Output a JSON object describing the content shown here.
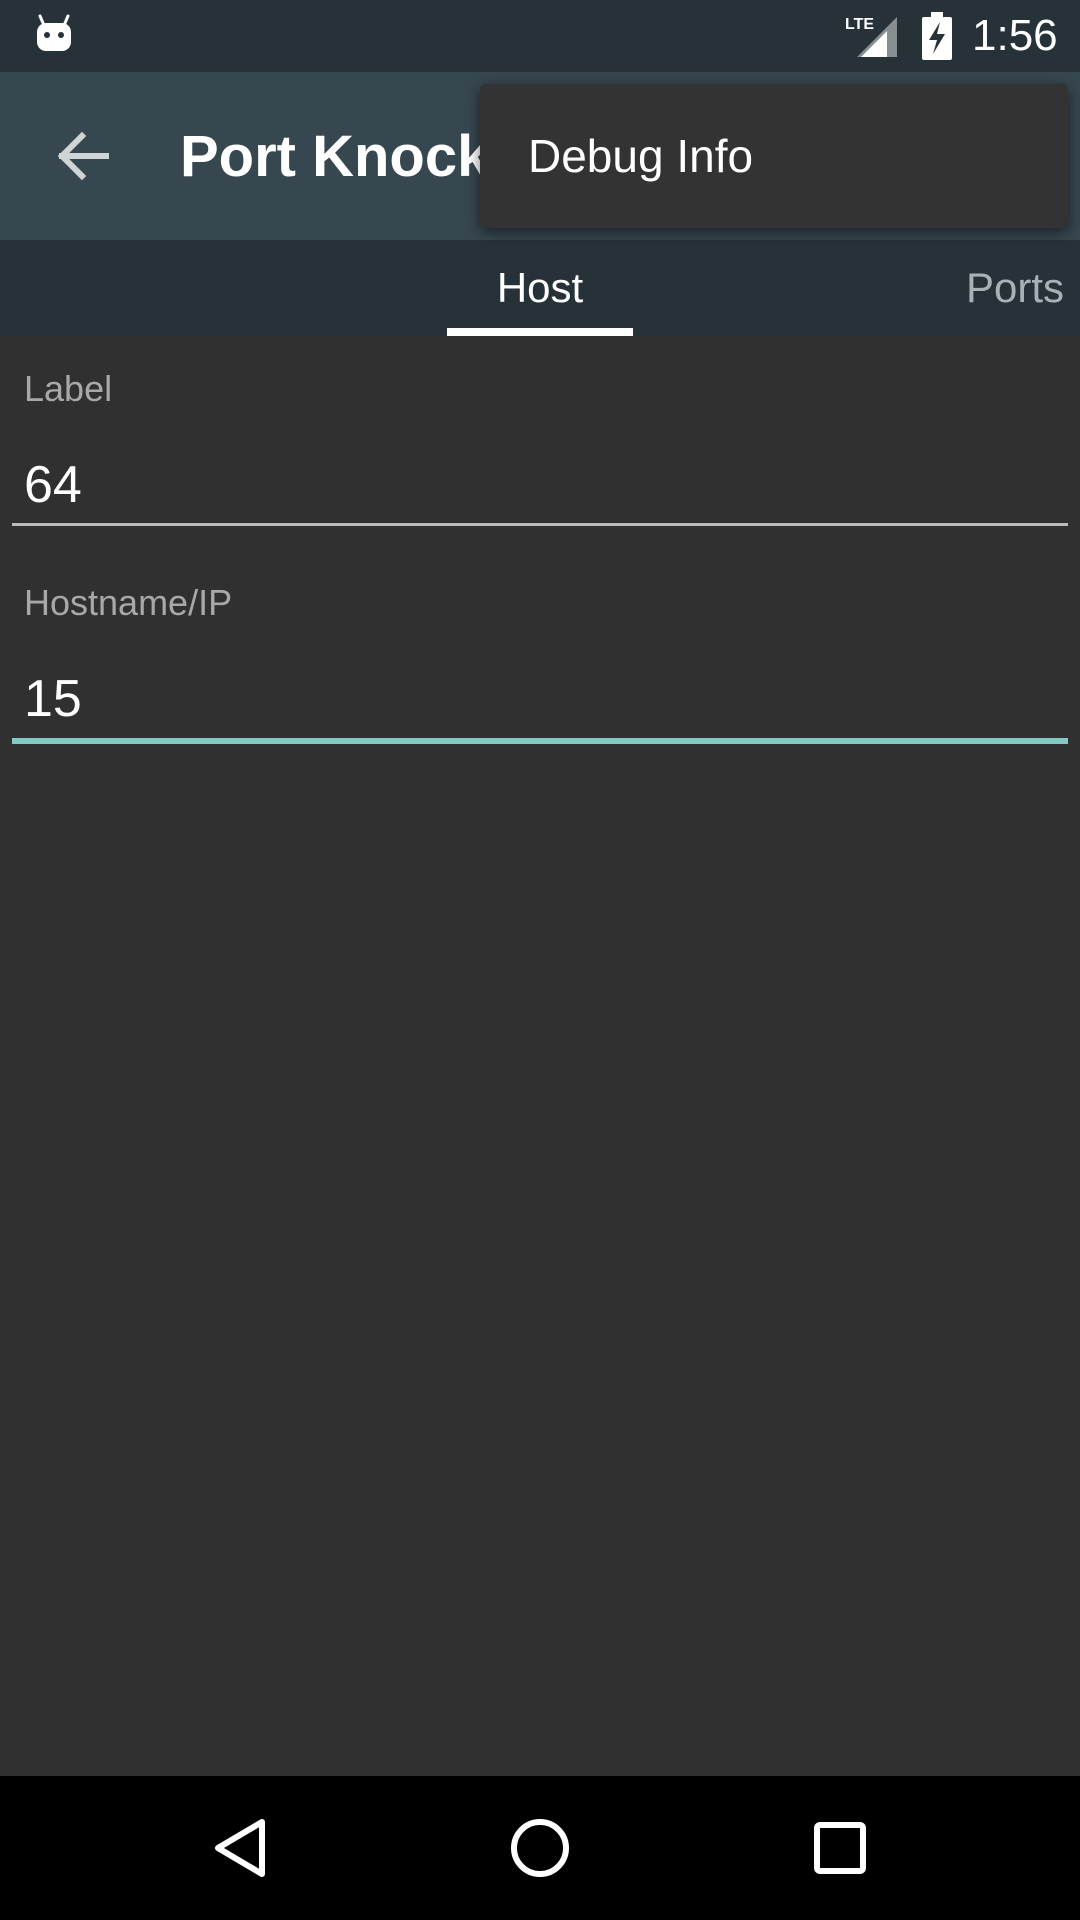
{
  "status_bar": {
    "time": "1:56",
    "network": "LTE",
    "icons": [
      "android-notification-icon",
      "lte-signal-icon",
      "battery-charging-icon"
    ]
  },
  "app_bar": {
    "title": "Port Knocker",
    "back_icon": "arrow-back-icon"
  },
  "tabs": [
    {
      "label": "Host",
      "selected": true
    },
    {
      "label": "Ports",
      "selected": false
    }
  ],
  "form": {
    "fields": [
      {
        "label": "Label",
        "value": "64",
        "focused": false
      },
      {
        "label": "Hostname/IP",
        "value": "15",
        "focused": true
      }
    ]
  },
  "overflow_menu": {
    "items": [
      "Debug Info"
    ]
  },
  "nav_bar": {
    "icons": [
      "back-triangle-icon",
      "home-circle-icon",
      "recents-square-icon"
    ]
  },
  "colors": {
    "status_bar": "#263238",
    "app_bar": "#37474F",
    "tab_strip": "#263238",
    "background": "#303030",
    "accent": "#80CBC4",
    "menu": "#333333"
  }
}
